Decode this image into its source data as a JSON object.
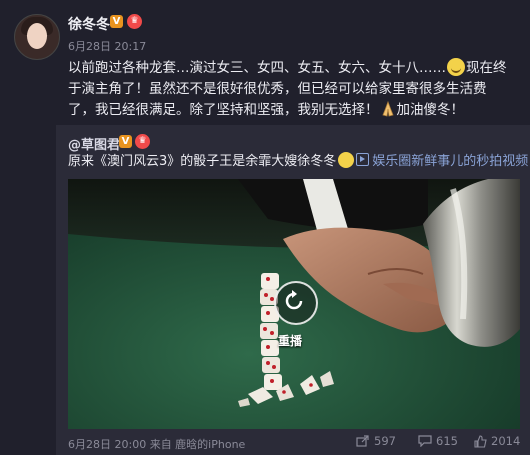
{
  "post": {
    "author": "徐冬冬",
    "time": "6月28日 20:17",
    "text_part1": "以前跑过各种龙套…演过女三、女四、女五、女六、女十八……",
    "text_part2": "现在终于演主角了！虽然还不是很好很优秀，但已经可以给家里寄很多生活费了，我已经很满足。除了坚持和坚强，我别无选择！",
    "text_part3": "加油傻冬！"
  },
  "repost": {
    "user": "@草图君",
    "text": "原来《澳门风云3》的骰子王是余霏大嫂徐冬冬",
    "video_link": "娱乐圈新鲜事儿的秒拍视频",
    "replay_label": "重播",
    "footer_time": "6月28日 20:00 来自 鹿晗的iPhone",
    "shares": "597",
    "comments": "615",
    "likes": "2014"
  },
  "colors": {
    "background": "#20202c",
    "repost_background": "#2b2b38",
    "link": "#8aa3d6",
    "muted": "#8a8a98",
    "v_badge": "#e8931f",
    "vip_badge": "#f04a4a",
    "table_felt": "#1f4d35"
  },
  "icons": {
    "v_badge": "verified-v-icon",
    "vip": "vip-crown-icon",
    "share": "share-icon",
    "comment": "comment-icon",
    "like": "like-thumb-icon",
    "replay": "replay-icon"
  }
}
